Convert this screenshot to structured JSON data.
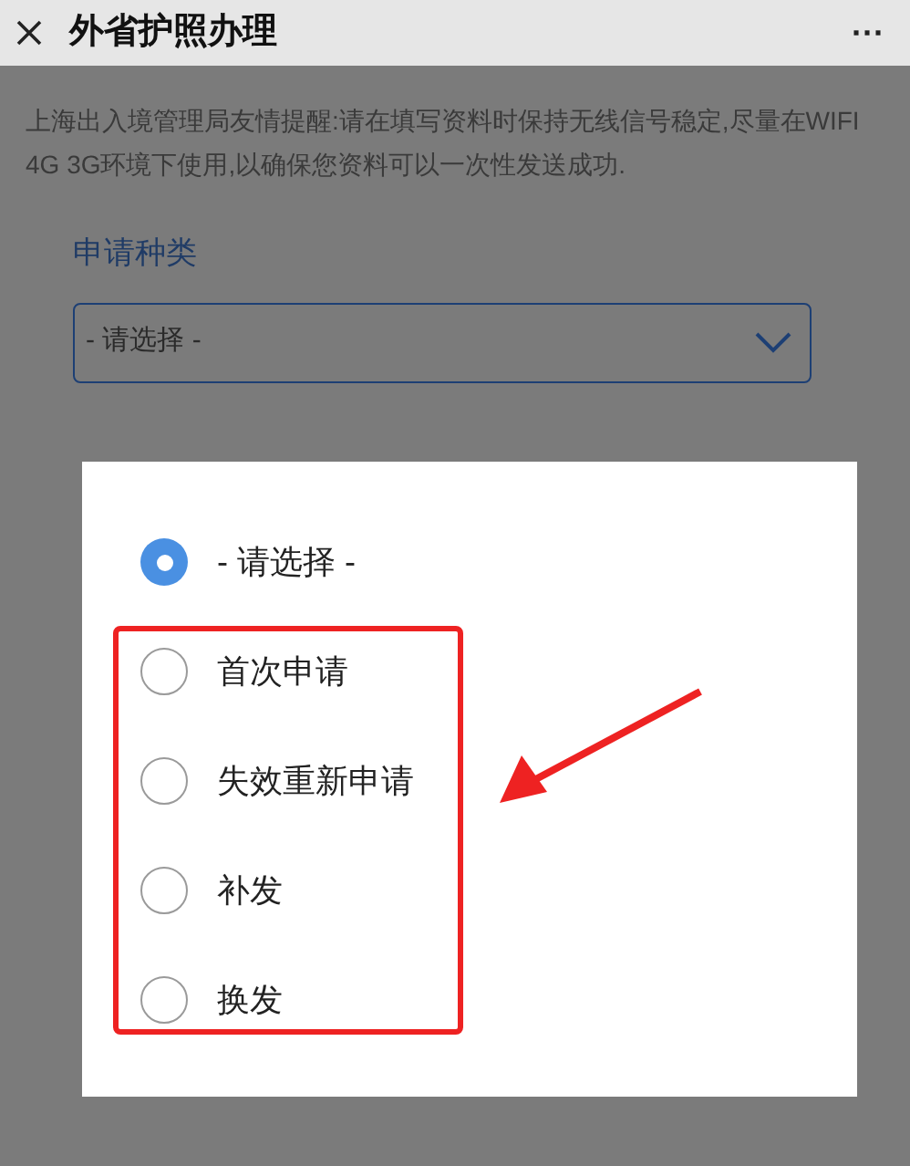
{
  "header": {
    "title": "外省护照办理",
    "menu": "···"
  },
  "notice": "上海出入境管理局友情提醒:请在填写资料时保持无线信号稳定,尽量在WIFI 4G 3G环境下使用,以确保您资料可以一次性发送成功.",
  "field": {
    "label": "申请种类",
    "value": "- 请选择 -"
  },
  "dialog": {
    "options": [
      {
        "label": "- 请选择 -",
        "selected": true
      },
      {
        "label": "首次申请",
        "selected": false
      },
      {
        "label": "失效重新申请",
        "selected": false
      },
      {
        "label": "补发",
        "selected": false
      },
      {
        "label": "换发",
        "selected": false
      }
    ]
  }
}
